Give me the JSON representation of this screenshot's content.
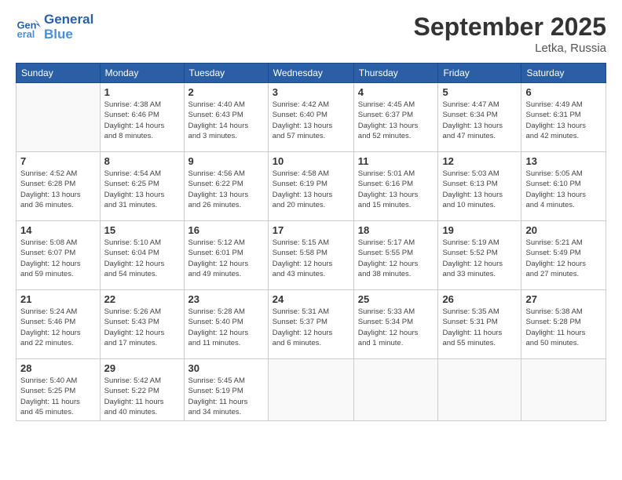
{
  "header": {
    "logo_line1": "General",
    "logo_line2": "Blue",
    "month": "September 2025",
    "location": "Letka, Russia"
  },
  "weekdays": [
    "Sunday",
    "Monday",
    "Tuesday",
    "Wednesday",
    "Thursday",
    "Friday",
    "Saturday"
  ],
  "weeks": [
    [
      {
        "day": "",
        "info": ""
      },
      {
        "day": "1",
        "info": "Sunrise: 4:38 AM\nSunset: 6:46 PM\nDaylight: 14 hours\nand 8 minutes."
      },
      {
        "day": "2",
        "info": "Sunrise: 4:40 AM\nSunset: 6:43 PM\nDaylight: 14 hours\nand 3 minutes."
      },
      {
        "day": "3",
        "info": "Sunrise: 4:42 AM\nSunset: 6:40 PM\nDaylight: 13 hours\nand 57 minutes."
      },
      {
        "day": "4",
        "info": "Sunrise: 4:45 AM\nSunset: 6:37 PM\nDaylight: 13 hours\nand 52 minutes."
      },
      {
        "day": "5",
        "info": "Sunrise: 4:47 AM\nSunset: 6:34 PM\nDaylight: 13 hours\nand 47 minutes."
      },
      {
        "day": "6",
        "info": "Sunrise: 4:49 AM\nSunset: 6:31 PM\nDaylight: 13 hours\nand 42 minutes."
      }
    ],
    [
      {
        "day": "7",
        "info": "Sunrise: 4:52 AM\nSunset: 6:28 PM\nDaylight: 13 hours\nand 36 minutes."
      },
      {
        "day": "8",
        "info": "Sunrise: 4:54 AM\nSunset: 6:25 PM\nDaylight: 13 hours\nand 31 minutes."
      },
      {
        "day": "9",
        "info": "Sunrise: 4:56 AM\nSunset: 6:22 PM\nDaylight: 13 hours\nand 26 minutes."
      },
      {
        "day": "10",
        "info": "Sunrise: 4:58 AM\nSunset: 6:19 PM\nDaylight: 13 hours\nand 20 minutes."
      },
      {
        "day": "11",
        "info": "Sunrise: 5:01 AM\nSunset: 6:16 PM\nDaylight: 13 hours\nand 15 minutes."
      },
      {
        "day": "12",
        "info": "Sunrise: 5:03 AM\nSunset: 6:13 PM\nDaylight: 13 hours\nand 10 minutes."
      },
      {
        "day": "13",
        "info": "Sunrise: 5:05 AM\nSunset: 6:10 PM\nDaylight: 13 hours\nand 4 minutes."
      }
    ],
    [
      {
        "day": "14",
        "info": "Sunrise: 5:08 AM\nSunset: 6:07 PM\nDaylight: 12 hours\nand 59 minutes."
      },
      {
        "day": "15",
        "info": "Sunrise: 5:10 AM\nSunset: 6:04 PM\nDaylight: 12 hours\nand 54 minutes."
      },
      {
        "day": "16",
        "info": "Sunrise: 5:12 AM\nSunset: 6:01 PM\nDaylight: 12 hours\nand 49 minutes."
      },
      {
        "day": "17",
        "info": "Sunrise: 5:15 AM\nSunset: 5:58 PM\nDaylight: 12 hours\nand 43 minutes."
      },
      {
        "day": "18",
        "info": "Sunrise: 5:17 AM\nSunset: 5:55 PM\nDaylight: 12 hours\nand 38 minutes."
      },
      {
        "day": "19",
        "info": "Sunrise: 5:19 AM\nSunset: 5:52 PM\nDaylight: 12 hours\nand 33 minutes."
      },
      {
        "day": "20",
        "info": "Sunrise: 5:21 AM\nSunset: 5:49 PM\nDaylight: 12 hours\nand 27 minutes."
      }
    ],
    [
      {
        "day": "21",
        "info": "Sunrise: 5:24 AM\nSunset: 5:46 PM\nDaylight: 12 hours\nand 22 minutes."
      },
      {
        "day": "22",
        "info": "Sunrise: 5:26 AM\nSunset: 5:43 PM\nDaylight: 12 hours\nand 17 minutes."
      },
      {
        "day": "23",
        "info": "Sunrise: 5:28 AM\nSunset: 5:40 PM\nDaylight: 12 hours\nand 11 minutes."
      },
      {
        "day": "24",
        "info": "Sunrise: 5:31 AM\nSunset: 5:37 PM\nDaylight: 12 hours\nand 6 minutes."
      },
      {
        "day": "25",
        "info": "Sunrise: 5:33 AM\nSunset: 5:34 PM\nDaylight: 12 hours\nand 1 minute."
      },
      {
        "day": "26",
        "info": "Sunrise: 5:35 AM\nSunset: 5:31 PM\nDaylight: 11 hours\nand 55 minutes."
      },
      {
        "day": "27",
        "info": "Sunrise: 5:38 AM\nSunset: 5:28 PM\nDaylight: 11 hours\nand 50 minutes."
      }
    ],
    [
      {
        "day": "28",
        "info": "Sunrise: 5:40 AM\nSunset: 5:25 PM\nDaylight: 11 hours\nand 45 minutes."
      },
      {
        "day": "29",
        "info": "Sunrise: 5:42 AM\nSunset: 5:22 PM\nDaylight: 11 hours\nand 40 minutes."
      },
      {
        "day": "30",
        "info": "Sunrise: 5:45 AM\nSunset: 5:19 PM\nDaylight: 11 hours\nand 34 minutes."
      },
      {
        "day": "",
        "info": ""
      },
      {
        "day": "",
        "info": ""
      },
      {
        "day": "",
        "info": ""
      },
      {
        "day": "",
        "info": ""
      }
    ]
  ]
}
